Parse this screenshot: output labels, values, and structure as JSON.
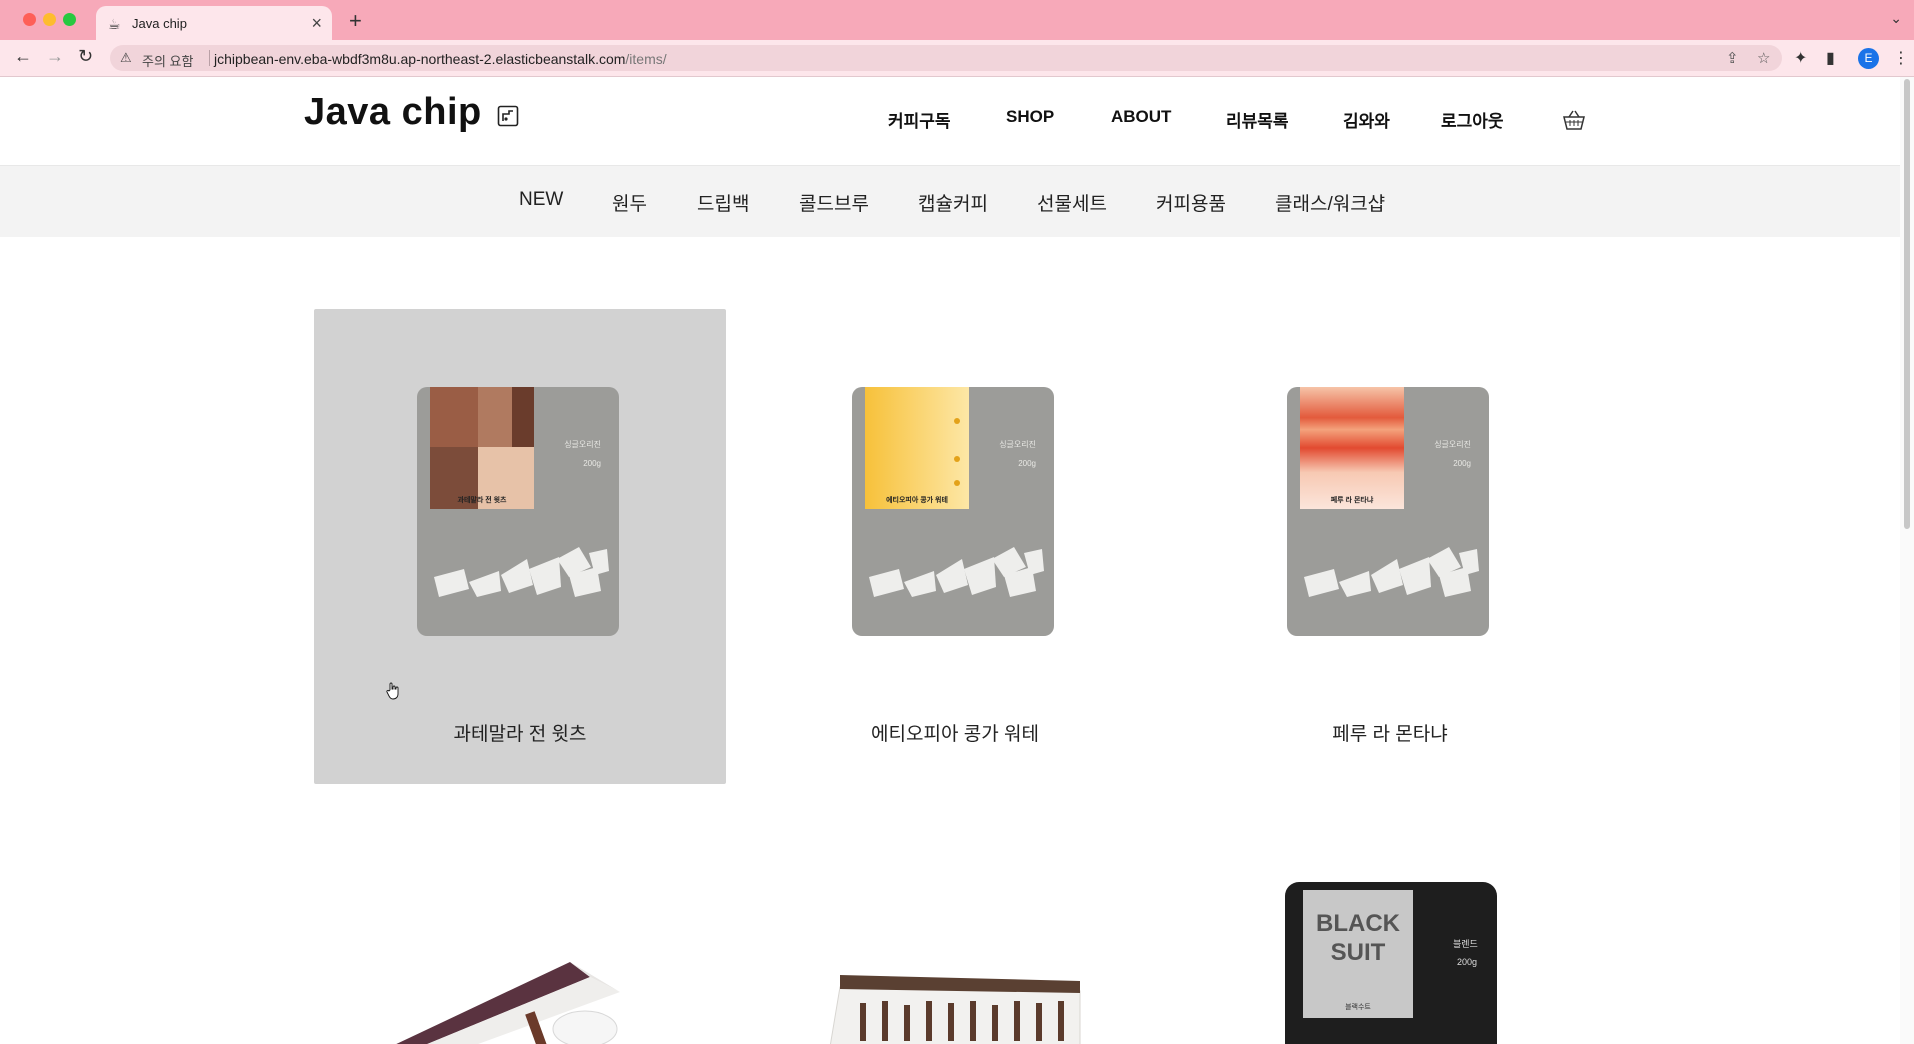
{
  "browser": {
    "tab_title": "Java chip",
    "security_label": "주의 요함",
    "url_host": "jchipbean-env.eba-wbdf3m8u.ap-northeast-2.elasticbeanstalk.com",
    "url_path": "/items/",
    "profile_initial": "E"
  },
  "site": {
    "logo": "Java chip",
    "main_nav": [
      "커피구독",
      "SHOP",
      "ABOUT",
      "리뷰목록",
      "김와와",
      "로그아웃"
    ],
    "categories": [
      "NEW",
      "원두",
      "드립백",
      "콜드브루",
      "캡슐커피",
      "선물세트",
      "커피용품",
      "클래스/워크샵"
    ]
  },
  "products": [
    {
      "name": "과테말라 전 윗츠",
      "bag_label": "과테말라 전 윗츠",
      "origin": "싱글오리진",
      "weight": "200g"
    },
    {
      "name": "에티오피아 콩가 워테",
      "bag_label": "에티오피아 콩가 워테",
      "origin": "싱글오리진",
      "weight": "200g"
    },
    {
      "name": "페루 라 몬타냐",
      "bag_label": "페루 라 몬타냐",
      "origin": "싱글오리진",
      "weight": "200g"
    }
  ],
  "second_row": {
    "black_suit_logo": "BLACK SUIT",
    "black_suit_side": "블렌드",
    "black_suit_weight": "200g",
    "black_suit_sub": "블랙수트"
  },
  "colors": {
    "chrome": "#f7a9b9",
    "toolbar": "#fde6eb",
    "category_bar": "#f3f3f3",
    "hover_card": "#d2d2d2",
    "bag_gray": "#9c9c99"
  }
}
